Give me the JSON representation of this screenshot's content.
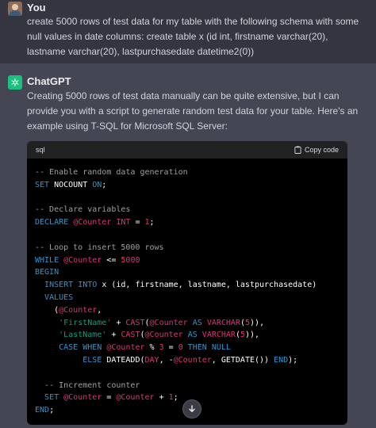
{
  "user": {
    "name": "You",
    "message": "create 5000 rows of test data for my table with the following schema with some null values in date columns: create table x (id int, firstname varchar(20), lastname varchar(20), lastpurchasedate datetime2(0))"
  },
  "assistant": {
    "name": "ChatGPT",
    "message": "Creating 5000 rows of test data manually can be quite extensive, but I can provide you with a script to generate random test data for your table. Here's an example using T-SQL for Microsoft SQL Server:",
    "code_block": {
      "language": "sql",
      "copy_label": "Copy code"
    }
  },
  "colors": {
    "accent": "#19c37d",
    "keyword": "#2e95d3",
    "variable": "#df3079",
    "string": "#00a67d",
    "comment": "#9aa0a6"
  },
  "icons": [
    "user-avatar",
    "chatgpt-logo-icon",
    "clipboard-icon",
    "arrow-down-icon"
  ]
}
